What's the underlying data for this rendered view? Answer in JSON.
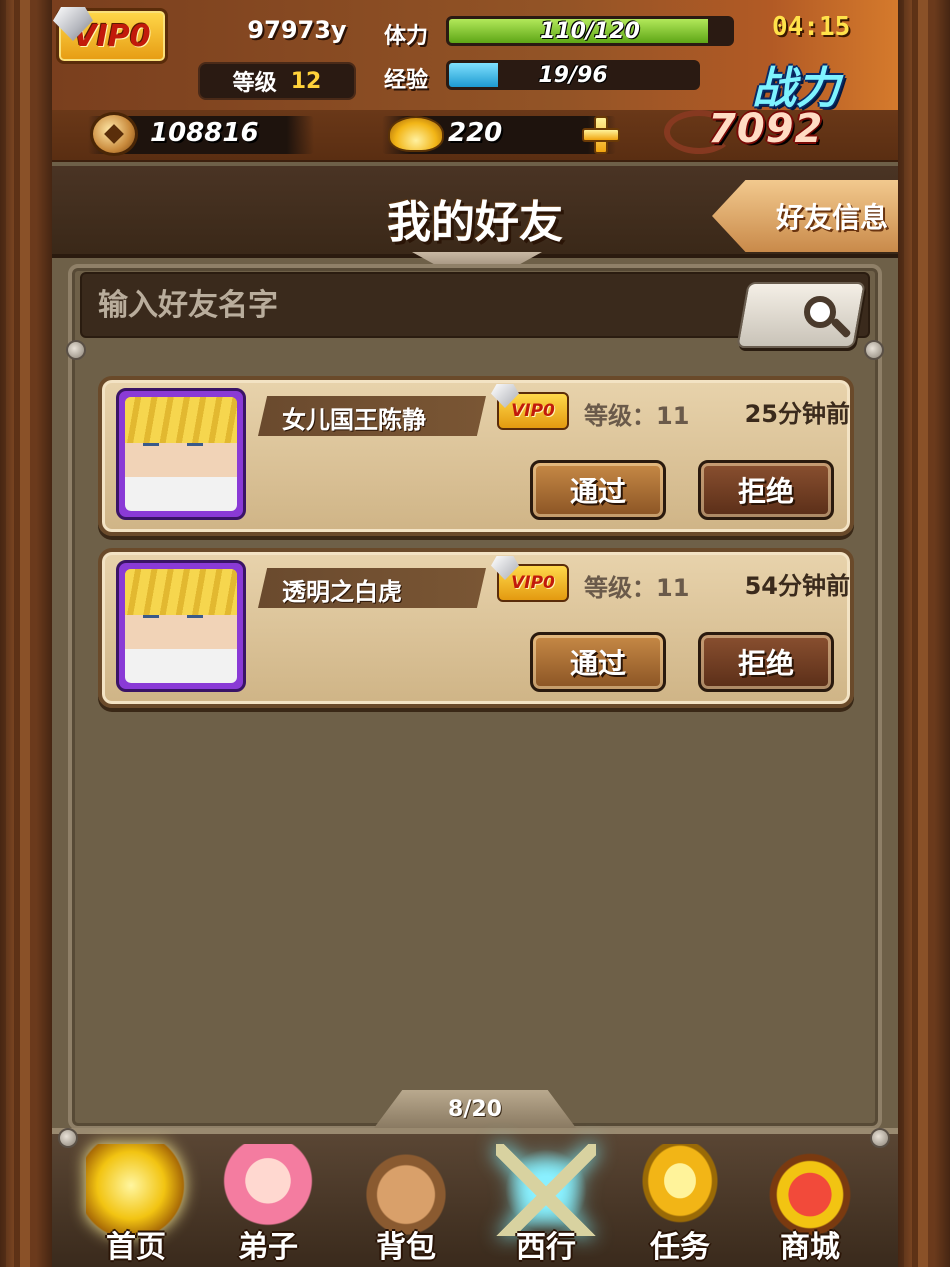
{
  "header": {
    "vip_label": "VIP0",
    "player_name": "97973y",
    "level_label": "等级",
    "level_value": "12",
    "stamina_label": "体力",
    "stamina_text": "110/120",
    "stamina_fraction": 0.917,
    "exp_label": "经验",
    "exp_text": "19/96",
    "exp_fraction": 0.198,
    "clock": "04:15",
    "power_label": "战力",
    "copper": "108816",
    "gold": "220",
    "power_value": "7092"
  },
  "title": {
    "text": "我的好友",
    "info_button": "好友信息"
  },
  "search": {
    "placeholder": "输入好友名字"
  },
  "requests": [
    {
      "name": "女儿国王陈静",
      "vip": "VIP0",
      "level": "等级：11",
      "time": "25分钟前",
      "accept": "通过",
      "reject": "拒绝"
    },
    {
      "name": "透明之白虎",
      "vip": "VIP0",
      "level": "等级：11",
      "time": "54分钟前",
      "accept": "通过",
      "reject": "拒绝"
    }
  ],
  "pager": "8/20",
  "nav": [
    {
      "label": "首页",
      "icon": "home-icon"
    },
    {
      "label": "弟子",
      "icon": "disciple-icon"
    },
    {
      "label": "背包",
      "icon": "backpack-icon"
    },
    {
      "label": "西行",
      "icon": "crossed-swords-icon"
    },
    {
      "label": "任务",
      "icon": "trophy-icon"
    },
    {
      "label": "商城",
      "icon": "treasure-chest-icon"
    }
  ],
  "colors": {
    "stamina_bar": "#7cc42a",
    "exp_bar": "#2fb6e8",
    "vip_gold": "#f2c412",
    "power_text": "#7ef3ff"
  }
}
